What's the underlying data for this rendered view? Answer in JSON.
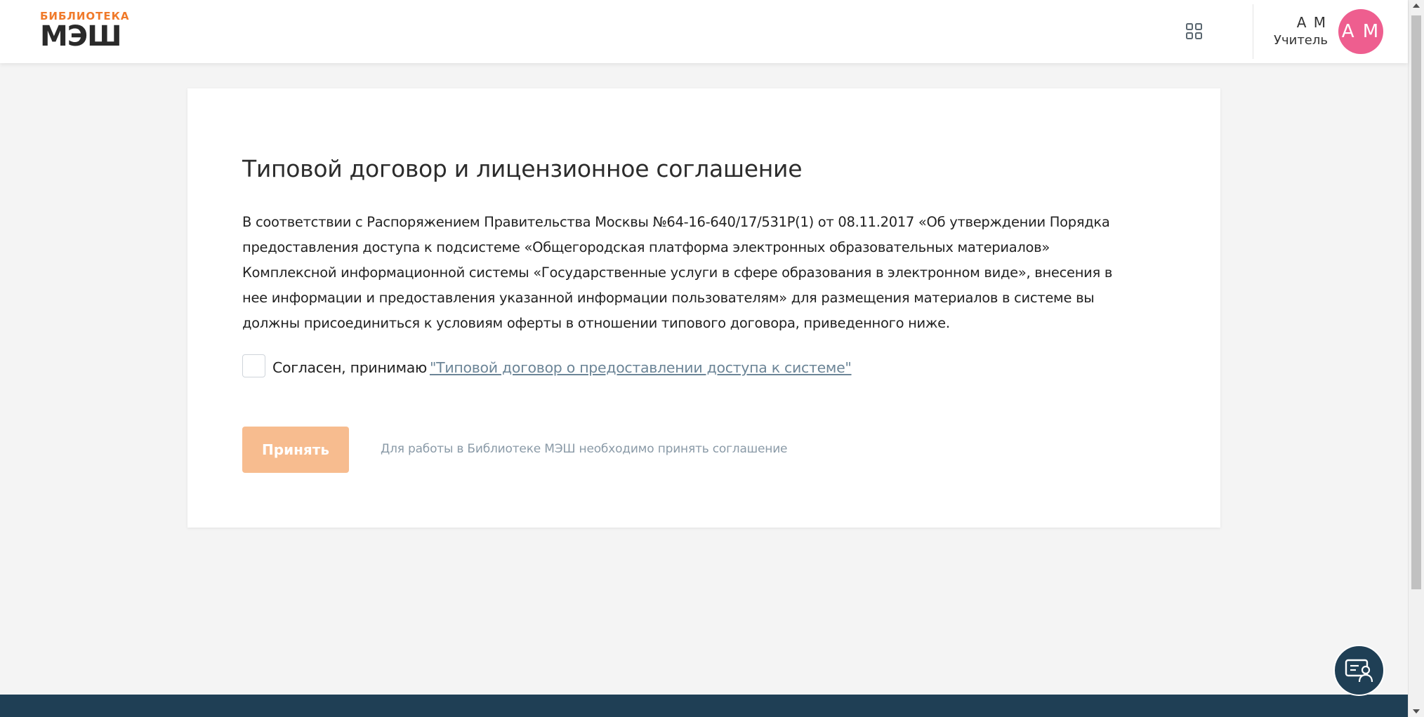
{
  "header": {
    "logo_top": "БИБЛИОТЕКА",
    "logo_main": "МЭШ",
    "apps_icon": "grid-icon",
    "user_name": "А М",
    "user_role": "Учитель",
    "avatar_initials": "А М",
    "avatar_color": "#ee5e8f",
    "brand_color": "#f07a2a"
  },
  "agreement": {
    "title": "Типовой договор и лицензионное соглашение",
    "text": "В соответствии с Распоряжением Правительства Москвы №64-16-640/17/531Р(1) от 08.11.2017 «Об утверждении Порядка предоставления доступа к подсистеме «Общегородская платформа электронных образовательных материалов» Комплексной информационной системы «Государственные услуги в сфере образования в электронном виде», внесения в нее информации и предоставления указанной информации пользователям» для размещения материалов в системе вы должны присоединиться к условиям оферты в отношении типового договора, приведенного ниже.",
    "checkbox_label": "Согласен, принимаю",
    "link_text": "\"Типовой договор о предоставлении доступа к системе\"",
    "checked": false,
    "accept_button": "Принять",
    "accept_hint": "Для работы в Библиотеке МЭШ необходимо принять соглашение"
  },
  "chat": {
    "icon": "support-chat-icon",
    "color": "#1f3f55"
  }
}
